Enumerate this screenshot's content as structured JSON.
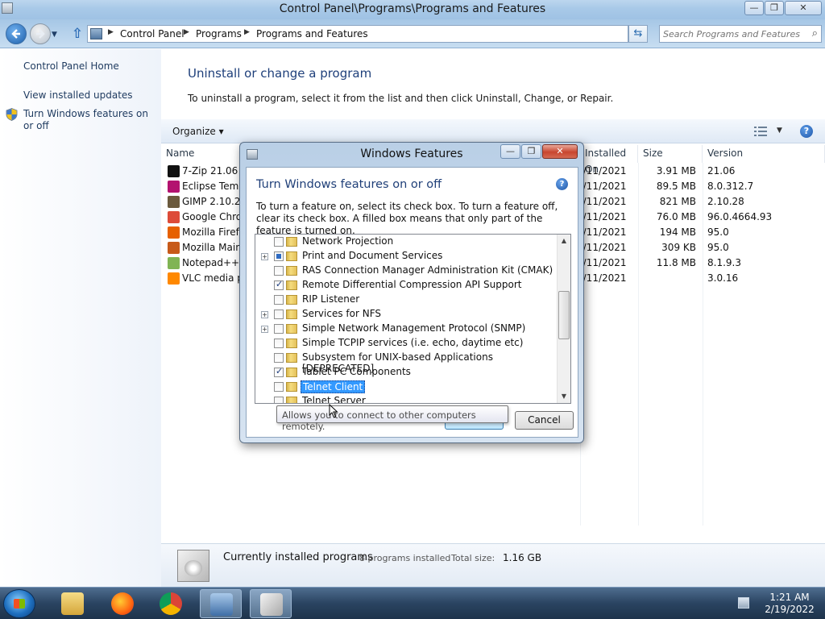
{
  "window": {
    "title": "Control Panel\\Programs\\Programs and Features",
    "min_glyph": "—",
    "max_glyph": "❐",
    "close_glyph": "✕"
  },
  "address": {
    "crumbs": [
      "Control Panel",
      "Programs",
      "Programs and Features"
    ],
    "separator": "▶",
    "search_placeholder": "Search Programs and Features"
  },
  "left_pane": {
    "home": "Control Panel Home",
    "updates": "View installed updates",
    "features": "Turn Windows features on or off"
  },
  "main": {
    "heading": "Uninstall or change a program",
    "description": "To uninstall a program, select it from the list and then click Uninstall, Change, or Repair.",
    "organize": "Organize ▾",
    "columns": {
      "name": "Name",
      "installed_on": "Installed On",
      "size": "Size",
      "version": "Version"
    }
  },
  "programs": [
    {
      "name": "7-Zip 21.06",
      "installed": "2/11/2021",
      "size": "3.91 MB",
      "version": "21.06",
      "icon_color": "#111111"
    },
    {
      "name": "Eclipse Temurin JDK",
      "installed": "2/11/2021",
      "size": "89.5 MB",
      "version": "8.0.312.7",
      "icon_color": "#b3126f"
    },
    {
      "name": "GIMP 2.10.28",
      "installed": "2/11/2021",
      "size": "821 MB",
      "version": "2.10.28",
      "icon_color": "#6b5a3d"
    },
    {
      "name": "Google Chrome",
      "installed": "2/11/2021",
      "size": "76.0 MB",
      "version": "96.0.4664.93",
      "icon_color": "#dd4b39"
    },
    {
      "name": "Mozilla Firefox",
      "installed": "2/11/2021",
      "size": "194 MB",
      "version": "95.0",
      "icon_color": "#e66000"
    },
    {
      "name": "Mozilla Maintenance Service",
      "installed": "2/11/2021",
      "size": "309 KB",
      "version": "95.0",
      "icon_color": "#c75a1a"
    },
    {
      "name": "Notepad++ (32-bit x86)",
      "installed": "2/11/2021",
      "size": "11.8 MB",
      "version": "8.1.9.3",
      "icon_color": "#80b454"
    },
    {
      "name": "VLC media player",
      "installed": "2/11/2021",
      "size": "",
      "version": "3.0.16",
      "icon_color": "#ff8800"
    }
  ],
  "status": {
    "main": "Currently installed programs",
    "count": "8 programs installed",
    "total_label": "Total size:",
    "total_value": "1.16 GB"
  },
  "dialog": {
    "title": "Windows Features",
    "heading": "Turn Windows features on or off",
    "description": "To turn a feature on, select its check box. To turn a feature off, clear its check box. A filled box means that only part of the feature is turned on.",
    "features": [
      {
        "label": "Network Projection",
        "state": "unchecked",
        "expandable": false
      },
      {
        "label": "Print and Document Services",
        "state": "partial",
        "expandable": true
      },
      {
        "label": "RAS Connection Manager Administration Kit (CMAK)",
        "state": "unchecked",
        "expandable": false
      },
      {
        "label": "Remote Differential Compression API Support",
        "state": "checked",
        "expandable": false
      },
      {
        "label": "RIP Listener",
        "state": "unchecked",
        "expandable": false
      },
      {
        "label": "Services for NFS",
        "state": "unchecked",
        "expandable": true
      },
      {
        "label": "Simple Network Management Protocol (SNMP)",
        "state": "unchecked",
        "expandable": true
      },
      {
        "label": "Simple TCPIP services (i.e. echo, daytime etc)",
        "state": "unchecked",
        "expandable": false
      },
      {
        "label": "Subsystem for UNIX-based Applications [DEPRECATED]",
        "state": "unchecked",
        "expandable": false
      },
      {
        "label": "Tablet PC Components",
        "state": "checked",
        "expandable": false
      },
      {
        "label": "Telnet Client",
        "state": "unchecked",
        "expandable": false,
        "selected": true
      },
      {
        "label": "Telnet Server",
        "state": "unchecked",
        "expandable": false
      }
    ],
    "ok_label": "OK",
    "cancel_label": "Cancel",
    "tooltip": "Allows you to connect to other computers remotely."
  },
  "taskbar": {
    "time": "1:21 AM",
    "date": "2/19/2022",
    "items": [
      "explorer-icon",
      "firefox-icon",
      "chrome-icon",
      "control-panel-icon",
      "programs-features-icon"
    ]
  }
}
